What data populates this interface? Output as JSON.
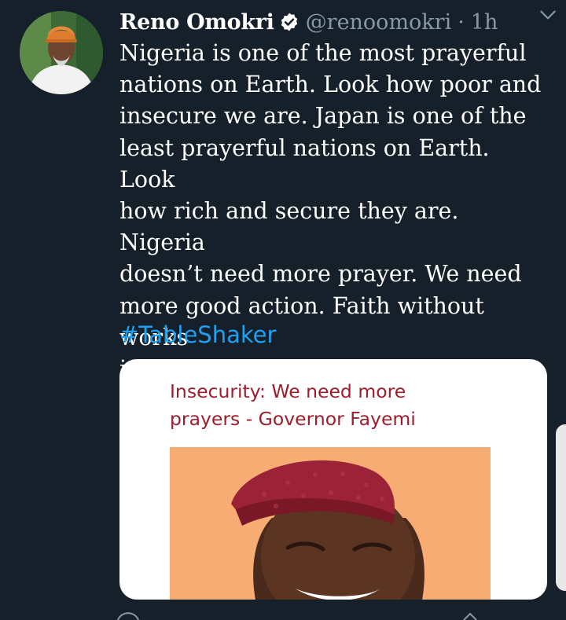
{
  "tweet": {
    "author_name": "Reno Omokri",
    "handle": "@renoomokri",
    "separator": "·",
    "time": "1h",
    "text": "Nigeria is one of the most prayerful\nnations on Earth. Look how poor and\ninsecure we are. Japan is one of the\nleast prayerful nations on Earth. Look\nhow rich and secure they are. Nigeria\ndoesn’t need more prayer. We need\nmore good action. Faith without works\nis DEAD",
    "hashtag": "#TableShaker"
  },
  "media_card": {
    "headline": "Insecurity: We need more\nprayers - Governor Fayemi"
  },
  "icons": {
    "verified": "verified-badge-icon",
    "more": "chevron-down-icon"
  },
  "colors": {
    "background": "#15202b",
    "text": "#ffffff",
    "muted": "#8899a6",
    "link": "#1da1f2",
    "headline": "#9e1d2c"
  }
}
